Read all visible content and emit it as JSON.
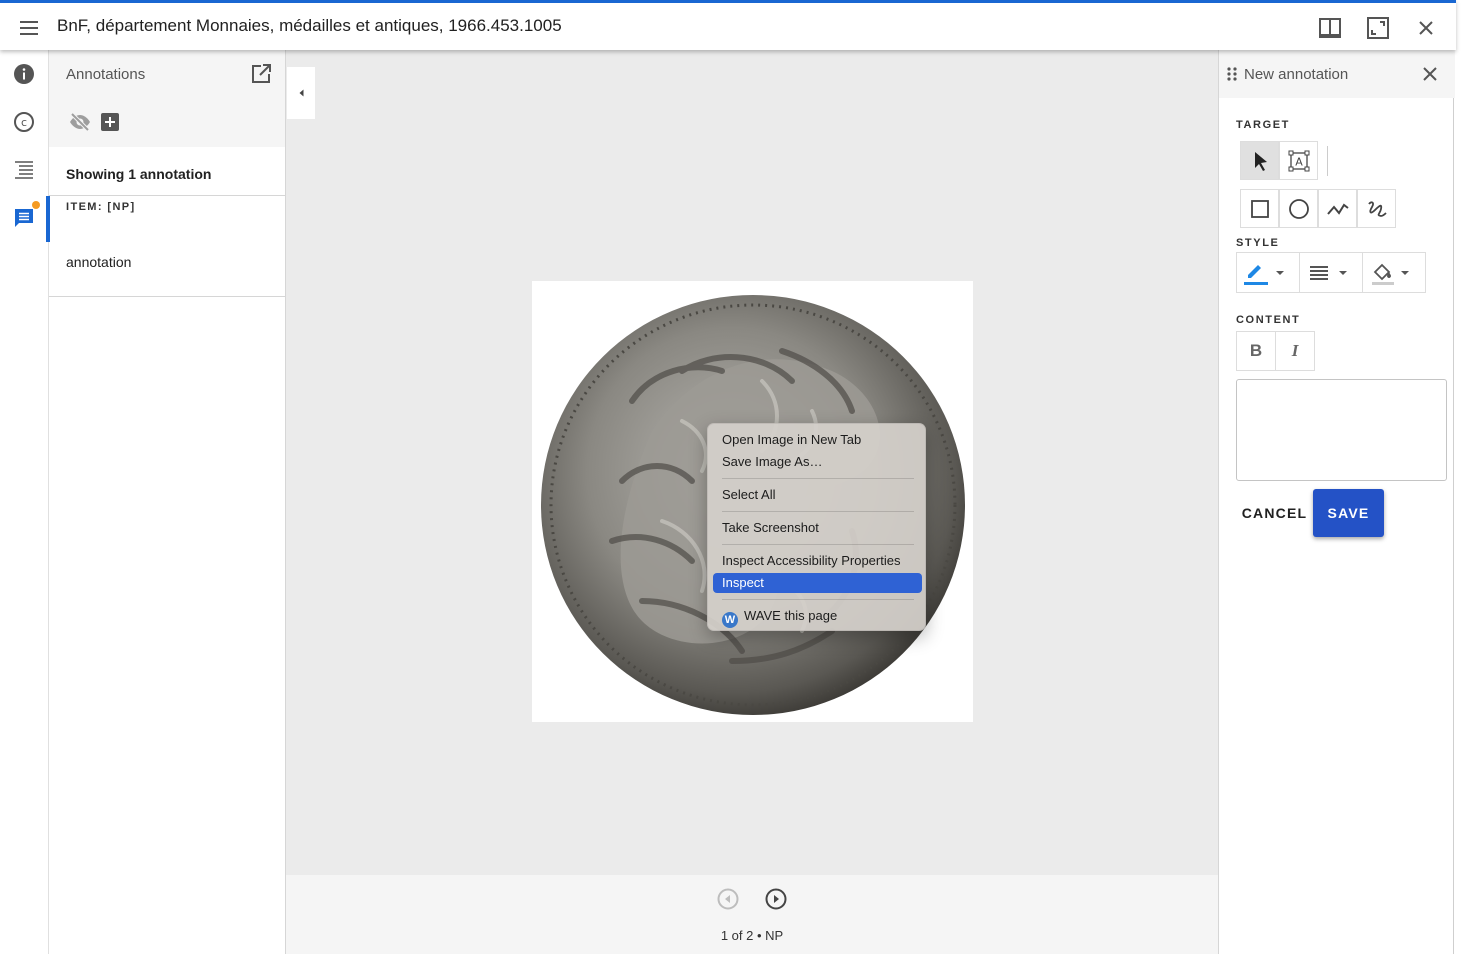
{
  "header": {
    "title": "BnF, département Monnaies, médailles et antiques, 1966.453.1005",
    "menu_icon": "hamburger-icon",
    "buttons": [
      "book-view-icon",
      "fullscreen-icon",
      "close-icon"
    ],
    "accent_color": "#1967d2"
  },
  "left_rail": {
    "items": [
      "info-icon",
      "copyright-icon",
      "index-icon",
      "annotations-icon"
    ],
    "active": "annotations-icon",
    "badge_color": "#f59b23"
  },
  "annotations_panel": {
    "title": "Annotations",
    "showing": "Showing 1 annotation",
    "items": [
      {
        "label": "ITEM: [NP]",
        "text": "annotation"
      }
    ]
  },
  "context_menu": {
    "items": [
      {
        "label": "Open Image in New Tab"
      },
      {
        "label": "Save Image As…"
      },
      {
        "label": "Select All"
      },
      {
        "label": "Take Screenshot"
      },
      {
        "label": "Inspect Accessibility Properties"
      },
      {
        "label": "Inspect",
        "selected": true
      },
      {
        "label": "WAVE this page"
      }
    ]
  },
  "footer": {
    "pager": "1 of 2 • NP"
  },
  "new_annotation": {
    "title": "New annotation",
    "target_label": "TARGET",
    "style_label": "STYLE",
    "content_label": "CONTENT",
    "cancel": "CANCEL",
    "save": "SAVE",
    "save_color": "#2452c6"
  }
}
